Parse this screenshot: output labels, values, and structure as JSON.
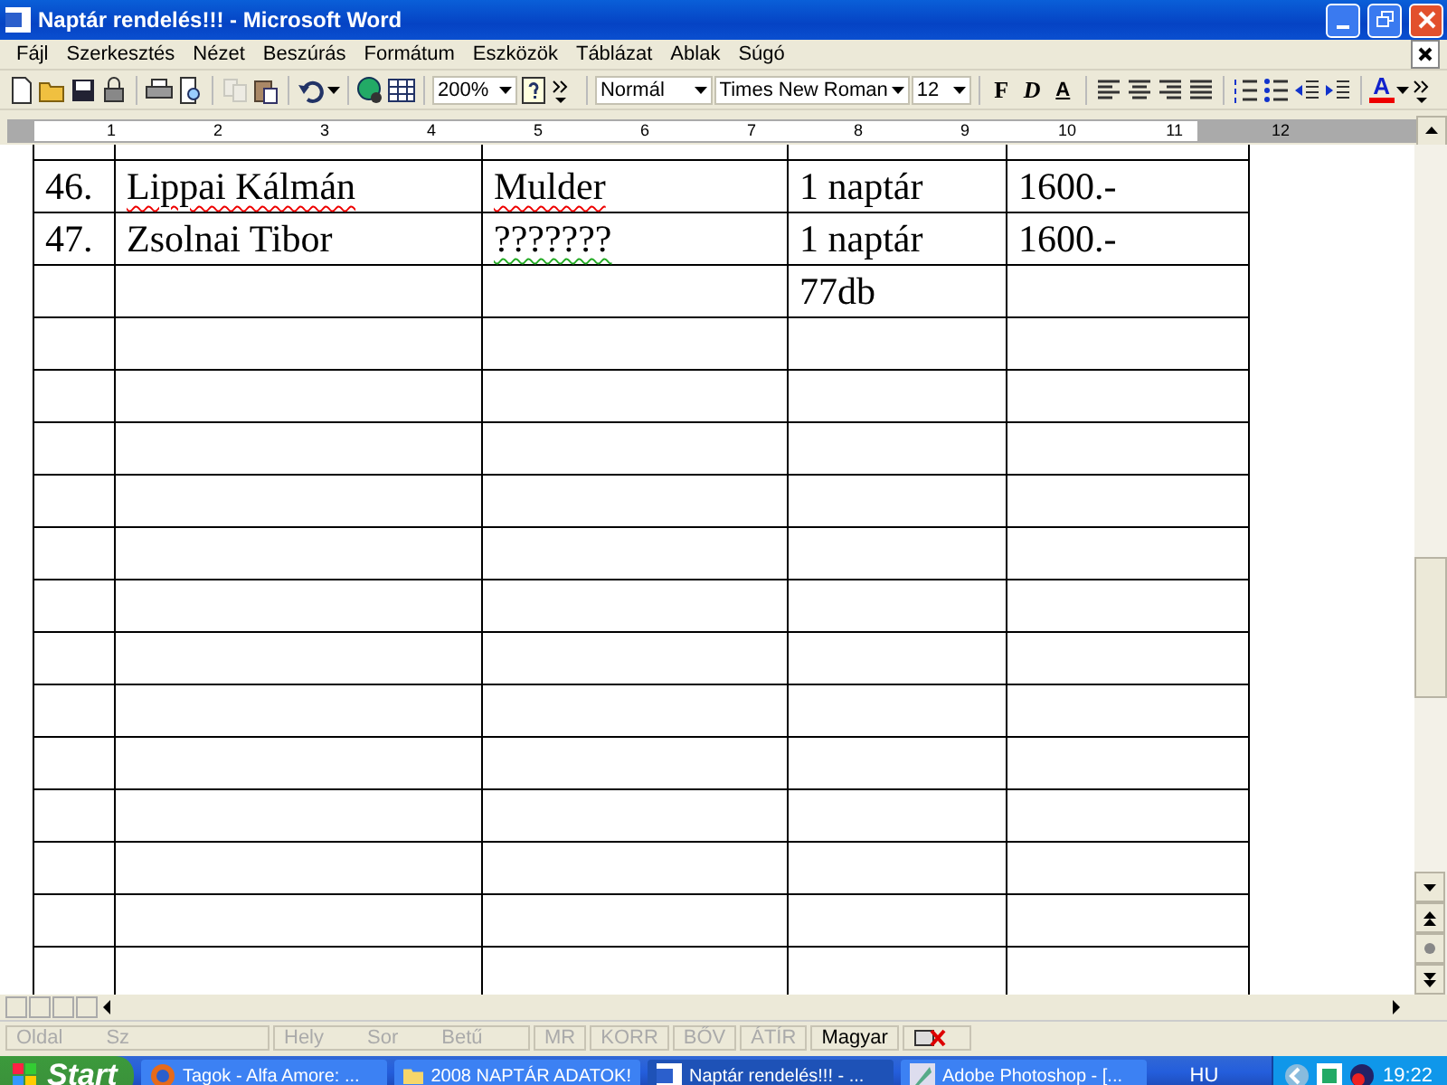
{
  "window": {
    "title": "Naptár rendelés!!! - Microsoft Word"
  },
  "menu": [
    "Fájl",
    "Szerkesztés",
    "Nézet",
    "Beszúrás",
    "Formátum",
    "Eszközök",
    "Táblázat",
    "Ablak",
    "Súgó"
  ],
  "toolbar": {
    "zoom": "200%",
    "style": "Normál",
    "font": "Times New Roman",
    "size": "12",
    "bold": "F",
    "italic": "D",
    "underline": "A",
    "font_color": "A"
  },
  "ruler": [
    "1",
    "2",
    "3",
    "4",
    "5",
    "6",
    "7",
    "8",
    "9",
    "10",
    "11",
    "12"
  ],
  "table": {
    "rows": [
      {
        "cells": [
          {
            "text": "46.",
            "misspelled": false,
            "grammar_error": false
          },
          {
            "text": "Lippai Kálmán",
            "misspelled": true,
            "grammar_error": false
          },
          {
            "text": "Mulder",
            "misspelled": true,
            "grammar_error": false
          },
          {
            "text": "1 naptár",
            "misspelled": false,
            "grammar_error": false
          },
          {
            "text": "1600.-",
            "misspelled": false,
            "grammar_error": false
          }
        ]
      },
      {
        "cells": [
          {
            "text": "47.",
            "misspelled": false,
            "grammar_error": false
          },
          {
            "text": "Zsolnai Tibor",
            "misspelled": false,
            "grammar_error": false
          },
          {
            "text": "???????",
            "misspelled": false,
            "grammar_error": true
          },
          {
            "text": "1 naptár",
            "misspelled": false,
            "grammar_error": false
          },
          {
            "text": "1600.-",
            "misspelled": false,
            "grammar_error": false
          }
        ]
      },
      {
        "cells": [
          {},
          {},
          {},
          {
            "text": "77db",
            "misspelled": false,
            "grammar_error": false
          },
          {}
        ]
      }
    ]
  },
  "status_bar": [
    {
      "text": "Oldal",
      "disabled": true
    },
    {
      "text": "Sz",
      "disabled": true
    },
    {
      "text": "Hely",
      "disabled": true
    },
    {
      "text": "Sor",
      "disabled": true
    },
    {
      "text": "Betű",
      "disabled": true
    },
    {
      "text": "MR",
      "disabled": true
    },
    {
      "text": "KORR",
      "disabled": true
    },
    {
      "text": "BŐV",
      "disabled": true
    },
    {
      "text": "ÁTÍR",
      "disabled": true
    },
    {
      "text": "Magyar",
      "disabled": false
    }
  ],
  "taskbar": {
    "start": "Start",
    "tasks": [
      {
        "label": "Tagok - Alfa Amore: ...",
        "kind": "browser",
        "selected": false
      },
      {
        "label": "2008 NAPTÁR ADATOK!",
        "kind": "folder",
        "selected": false
      },
      {
        "label": "Naptár rendelés!!! - ...",
        "kind": "word",
        "selected": true
      },
      {
        "label": "Adobe Photoshop - [...",
        "kind": "photoshop",
        "selected": false
      }
    ],
    "language": "HU",
    "clock": "19:22"
  }
}
